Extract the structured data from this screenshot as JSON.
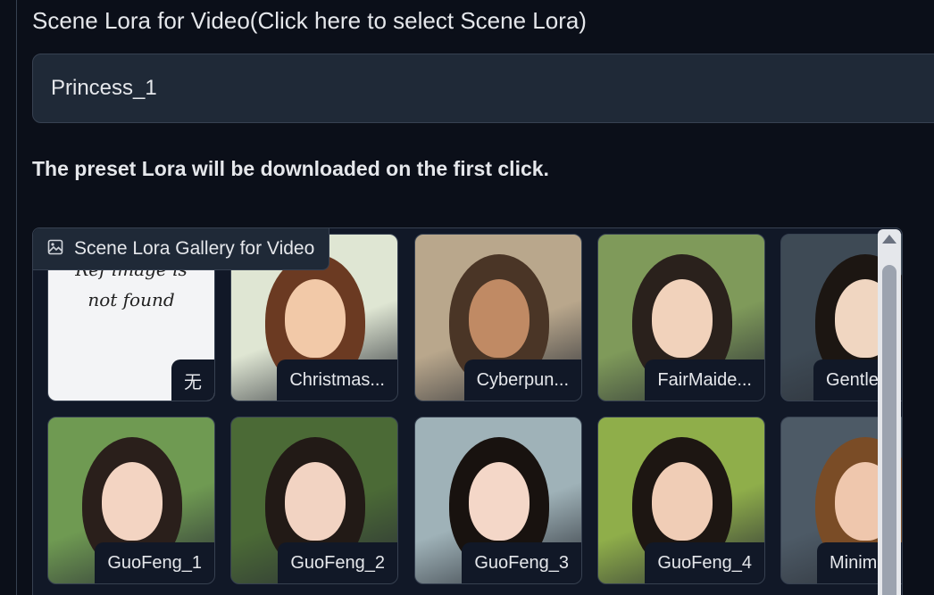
{
  "section": {
    "label": "Scene Lora for Video(Click here to select Scene Lora)"
  },
  "dropdown": {
    "value": "Princess_1"
  },
  "note": "The preset Lora will be downloaded on the first click.",
  "gallery": {
    "label": "Scene Lora Gallery for Video",
    "placeholder_text": [
      "Ref image is",
      "not found"
    ],
    "items": [
      {
        "caption": "无",
        "palette": [
          "#f3f4f6",
          "#f3f4f6",
          "#f3f4f6"
        ]
      },
      {
        "caption": "Christmas...",
        "palette": [
          "#dfe6d3",
          "#6b3a22",
          "#f2c9a8"
        ]
      },
      {
        "caption": "Cyberpun...",
        "palette": [
          "#b9a78c",
          "#4a3526",
          "#c08a64"
        ]
      },
      {
        "caption": "FairMaide...",
        "palette": [
          "#7f9a5a",
          "#2a211c",
          "#f1d2bb"
        ]
      },
      {
        "caption": "Gentle...",
        "palette": [
          "#3e4a55",
          "#1c1612",
          "#f0d6c1"
        ]
      },
      {
        "caption": "GuoFeng_1",
        "palette": [
          "#6f9a52",
          "#2a1f1b",
          "#f3d4c2"
        ]
      },
      {
        "caption": "GuoFeng_2",
        "palette": [
          "#4b6a36",
          "#221a16",
          "#f2d3c2"
        ]
      },
      {
        "caption": "GuoFeng_3",
        "palette": [
          "#9fb2b8",
          "#18120f",
          "#f4d7c8"
        ]
      },
      {
        "caption": "GuoFeng_4",
        "palette": [
          "#8fae4a",
          "#1d1612",
          "#f0cdb6"
        ]
      },
      {
        "caption": "Minim...",
        "palette": [
          "#4d5a66",
          "#7a4c26",
          "#efc7ad"
        ]
      }
    ]
  },
  "colors": {
    "background": "#0b0f19",
    "panel": "#1f2937",
    "border": "#374151",
    "text": "#e5e7eb"
  },
  "icons": {
    "gallery": "image-icon",
    "scroll": "scroll-up-arrow-icon"
  }
}
